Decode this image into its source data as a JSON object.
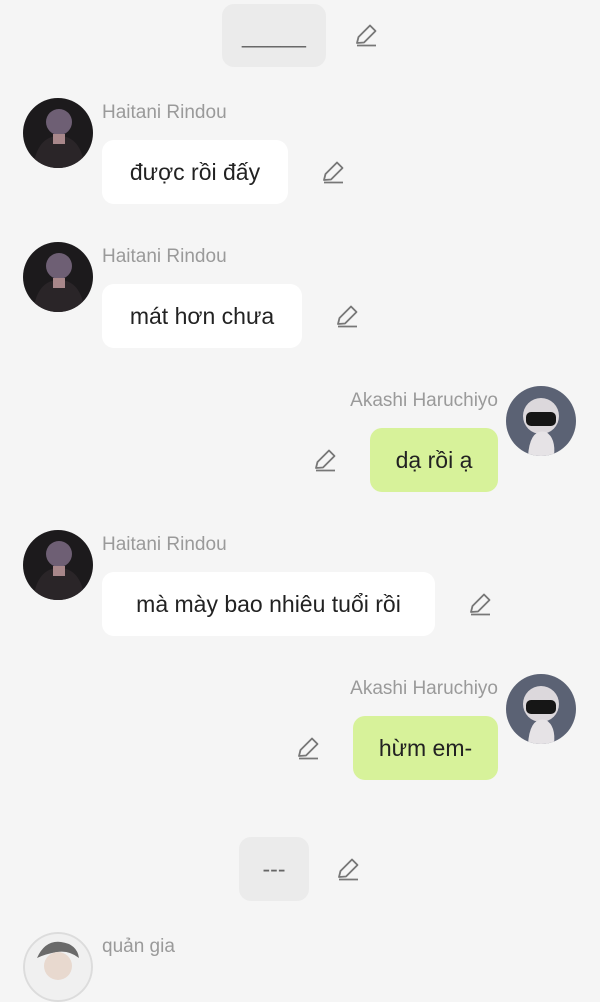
{
  "colors": {
    "background": "#f5f5f5",
    "incoming_bubble": "#ffffff",
    "outgoing_bubble": "#d7f29a",
    "system_bubble": "#ebebeb",
    "name_text": "#9a9a9a"
  },
  "messages": [
    {
      "type": "system",
      "text": "_____"
    },
    {
      "type": "incoming",
      "sender": "Haitani Rindou",
      "text": "được rồi đấy"
    },
    {
      "type": "incoming",
      "sender": "Haitani Rindou",
      "text": "mát hơn chưa"
    },
    {
      "type": "outgoing",
      "sender": "Akashi Haruchiyo",
      "text": "dạ rồi ạ"
    },
    {
      "type": "incoming",
      "sender": "Haitani Rindou",
      "text": "mà mày bao nhiêu tuổi rồi"
    },
    {
      "type": "outgoing",
      "sender": "Akashi Haruchiyo",
      "text": "hừm em-"
    },
    {
      "type": "system",
      "text": "---"
    },
    {
      "type": "incoming",
      "sender": "quản gia",
      "text": ""
    }
  ],
  "icons": {
    "edit": "pencil-edit-icon",
    "avatar_rindou": "avatar-haitani-rindou",
    "avatar_akashi": "avatar-akashi-haruchiyo",
    "avatar_quan_gia": "avatar-quan-gia"
  }
}
